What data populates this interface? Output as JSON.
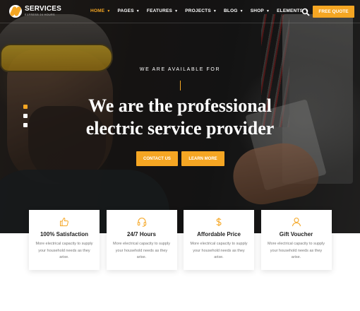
{
  "header": {
    "logo_title": "SERVICES",
    "logo_subtitle": "EXPRESS 24 HOURS",
    "nav": [
      {
        "label": "HOME",
        "active": true
      },
      {
        "label": "PAGES"
      },
      {
        "label": "FEATURES"
      },
      {
        "label": "PROJECTS"
      },
      {
        "label": "BLOG"
      },
      {
        "label": "SHOP"
      },
      {
        "label": "ELEMENTS"
      }
    ],
    "quote_button": "FREE QUOTE",
    "search_icon": "search-icon"
  },
  "hero": {
    "eyebrow": "WE ARE AVAILABLE FOR",
    "headline_line1": "We are the professional",
    "headline_line2": "electric service provider",
    "contact_button": "CONTACT US",
    "learn_button": "LEARN MORE",
    "slide_count": 3,
    "active_slide": 1
  },
  "features": [
    {
      "icon": "thumbs-up-icon",
      "title": "100% Satisfaction",
      "text": "More electrical capacity to supply your household needs as they arise."
    },
    {
      "icon": "headset-icon",
      "title": "24/7 Hours",
      "text": "More electrical capacity to supply your household needs as they arise."
    },
    {
      "icon": "dollar-icon",
      "title": "Affordable Price",
      "text": "More electrical capacity to supply your household needs as they arise."
    },
    {
      "icon": "user-icon",
      "title": "Gift Voucher",
      "text": "More electrical capacity to supply your household needs as they arise."
    }
  ],
  "colors": {
    "accent": "#f5a623",
    "hero_overlay": "#1a1a1a",
    "card_bg": "#ffffff"
  }
}
